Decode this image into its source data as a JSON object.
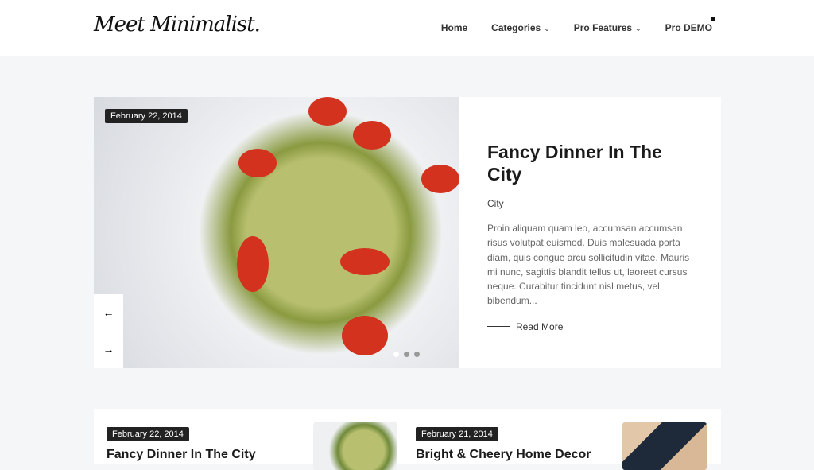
{
  "header": {
    "logo": "Meet Minimalist.",
    "nav": [
      {
        "label": "Home"
      },
      {
        "label": "Categories",
        "dropdown": true
      },
      {
        "label": "Pro Features",
        "dropdown": true
      },
      {
        "label": "Pro DEMO"
      }
    ]
  },
  "slider": {
    "date": "February 22, 2014",
    "title": "Fancy Dinner In The City",
    "category": "City",
    "excerpt": "Proin aliquam quam leo, accumsan accumsan risus volutpat euismod. Duis malesuada porta diam, quis congue arcu sollicitudin vitae. Mauris mi nunc, sagittis blandit tellus ut, laoreet cursus neque. Curabitur tincidunt nisl metus, vel bibendum...",
    "read_more": "Read More",
    "prev_icon": "←",
    "next_icon": "→",
    "slide_count": 3,
    "active_slide": 1
  },
  "posts": [
    {
      "date": "February 22, 2014",
      "title": "Fancy Dinner In The City"
    },
    {
      "date": "February 21, 2014",
      "title": "Bright & Cheery Home Decor"
    }
  ]
}
